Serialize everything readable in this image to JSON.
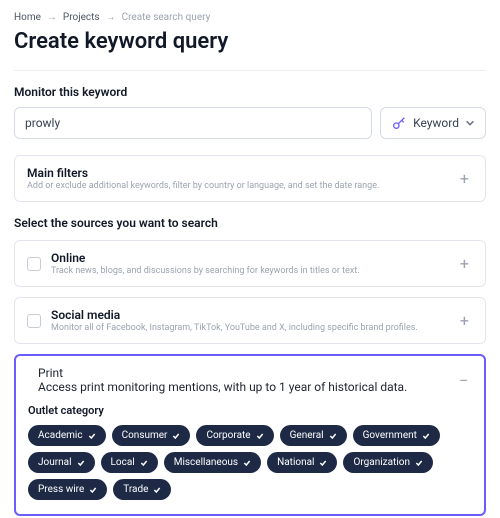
{
  "breadcrumb": {
    "home": "Home",
    "projects": "Projects",
    "current": "Create search query"
  },
  "page_title": "Create keyword query",
  "monitor": {
    "label": "Monitor this keyword",
    "value": "prowly",
    "type_label": "Keyword"
  },
  "main_filters": {
    "title": "Main filters",
    "desc": "Add or exclude additional keywords, filter by country or language, and set the date range."
  },
  "sources_label": "Select the sources you want to search",
  "sources": {
    "online": {
      "title": "Online",
      "desc": "Track news, blogs, and discussions by searching for keywords in titles or text."
    },
    "social": {
      "title": "Social media",
      "desc": "Monitor all of Facebook, Instagram, TikTok, YouTube and X, including specific brand profiles."
    },
    "print": {
      "title": "Print",
      "desc": "Access print monitoring mentions, with up to 1 year of historical data.",
      "outlet_label": "Outlet category",
      "chips": [
        "Academic",
        "Consumer",
        "Corporate",
        "General",
        "Government",
        "Journal",
        "Local",
        "Miscellaneous",
        "National",
        "Organization",
        "Press wire",
        "Trade"
      ]
    }
  }
}
